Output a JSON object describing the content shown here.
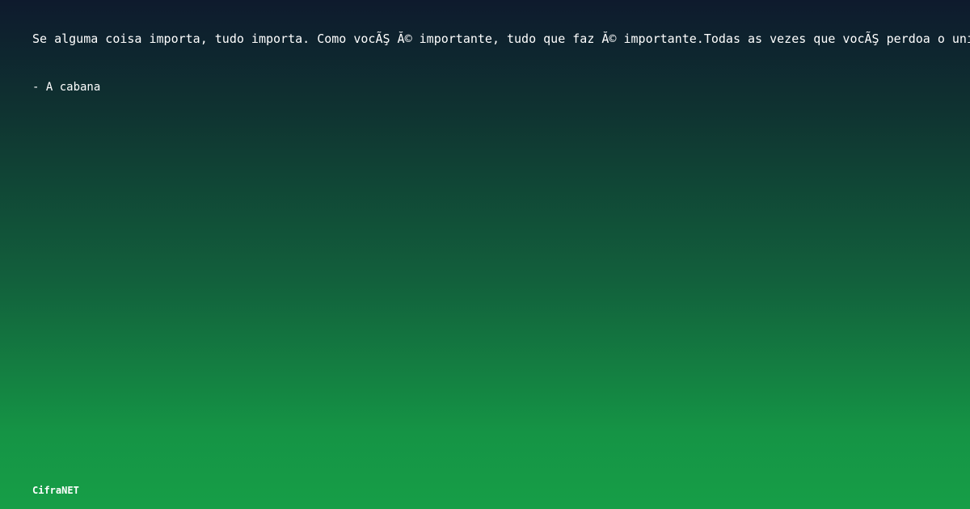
{
  "quote": {
    "text": "Se alguma coisa importa, tudo importa. Como vocÃŞ Ă© importante, tudo que faz Ă© importante.Todas as vezes que vocÃŞ perdoa o universo muda"
  },
  "author": {
    "text": "- A cabana"
  },
  "brand": {
    "name": "CifraNET"
  }
}
